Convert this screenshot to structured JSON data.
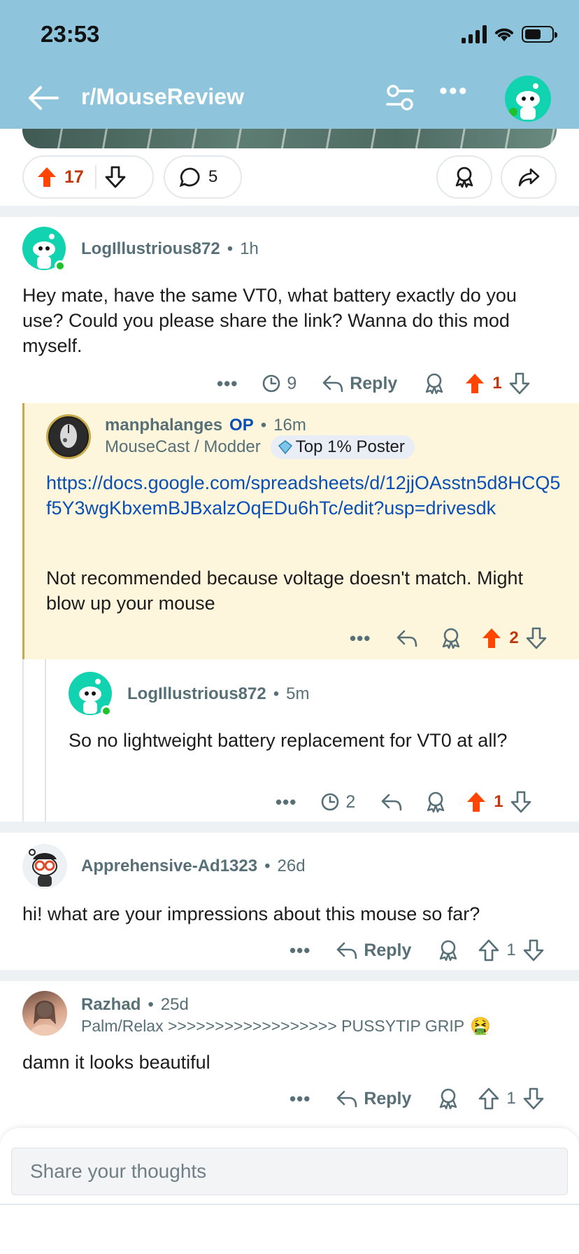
{
  "status": {
    "time": "23:53"
  },
  "nav": {
    "title": "r/MouseReview"
  },
  "post": {
    "upvotes": "17",
    "comments": "5"
  },
  "comments": [
    {
      "author": "LogIllustrious872",
      "time": "1h",
      "body": "Hey mate, have the same VT0, what battery exactly do you use? Could you please share the link? Wanna do this mod myself.",
      "awards": "9",
      "reply": "Reply",
      "votes": "1"
    },
    {
      "author": "manphalanges",
      "op": "OP",
      "time": "16m",
      "flair": "MouseCast / Modder",
      "badge": "Top 1% Poster",
      "link": "https://docs.google.com/spreadsheets/d/12jjOAsstn5d8HCQ5f5Y3wgKbxemBJBxalzOqEDu6hTc/edit?usp=drivesdk",
      "body": "Not recommended because voltage doesn't match. Might blow up your mouse",
      "votes": "2"
    },
    {
      "author": "LogIllustrious872",
      "time": "5m",
      "body": "So no lightweight battery replacement for VT0 at all?",
      "awards": "2",
      "votes": "1"
    },
    {
      "author": "Apprehensive-Ad1323",
      "time": "26d",
      "body": "hi! what are your impressions about this mouse so far?",
      "reply": "Reply",
      "votes": "1"
    },
    {
      "author": "Razhad",
      "time": "25d",
      "flair": "Palm/Relax >>>>>>>>>>>>>>>>>> PUSSYTIP GRIP",
      "body": "damn it looks beautiful",
      "reply": "Reply",
      "votes": "1"
    }
  ],
  "composer": {
    "placeholder": "Share your thoughts"
  },
  "colors": {
    "header": "#8ec5dc",
    "upvote": "#ff4500",
    "op_highlight": "#fdf6dc",
    "link": "#0a4fb5"
  }
}
